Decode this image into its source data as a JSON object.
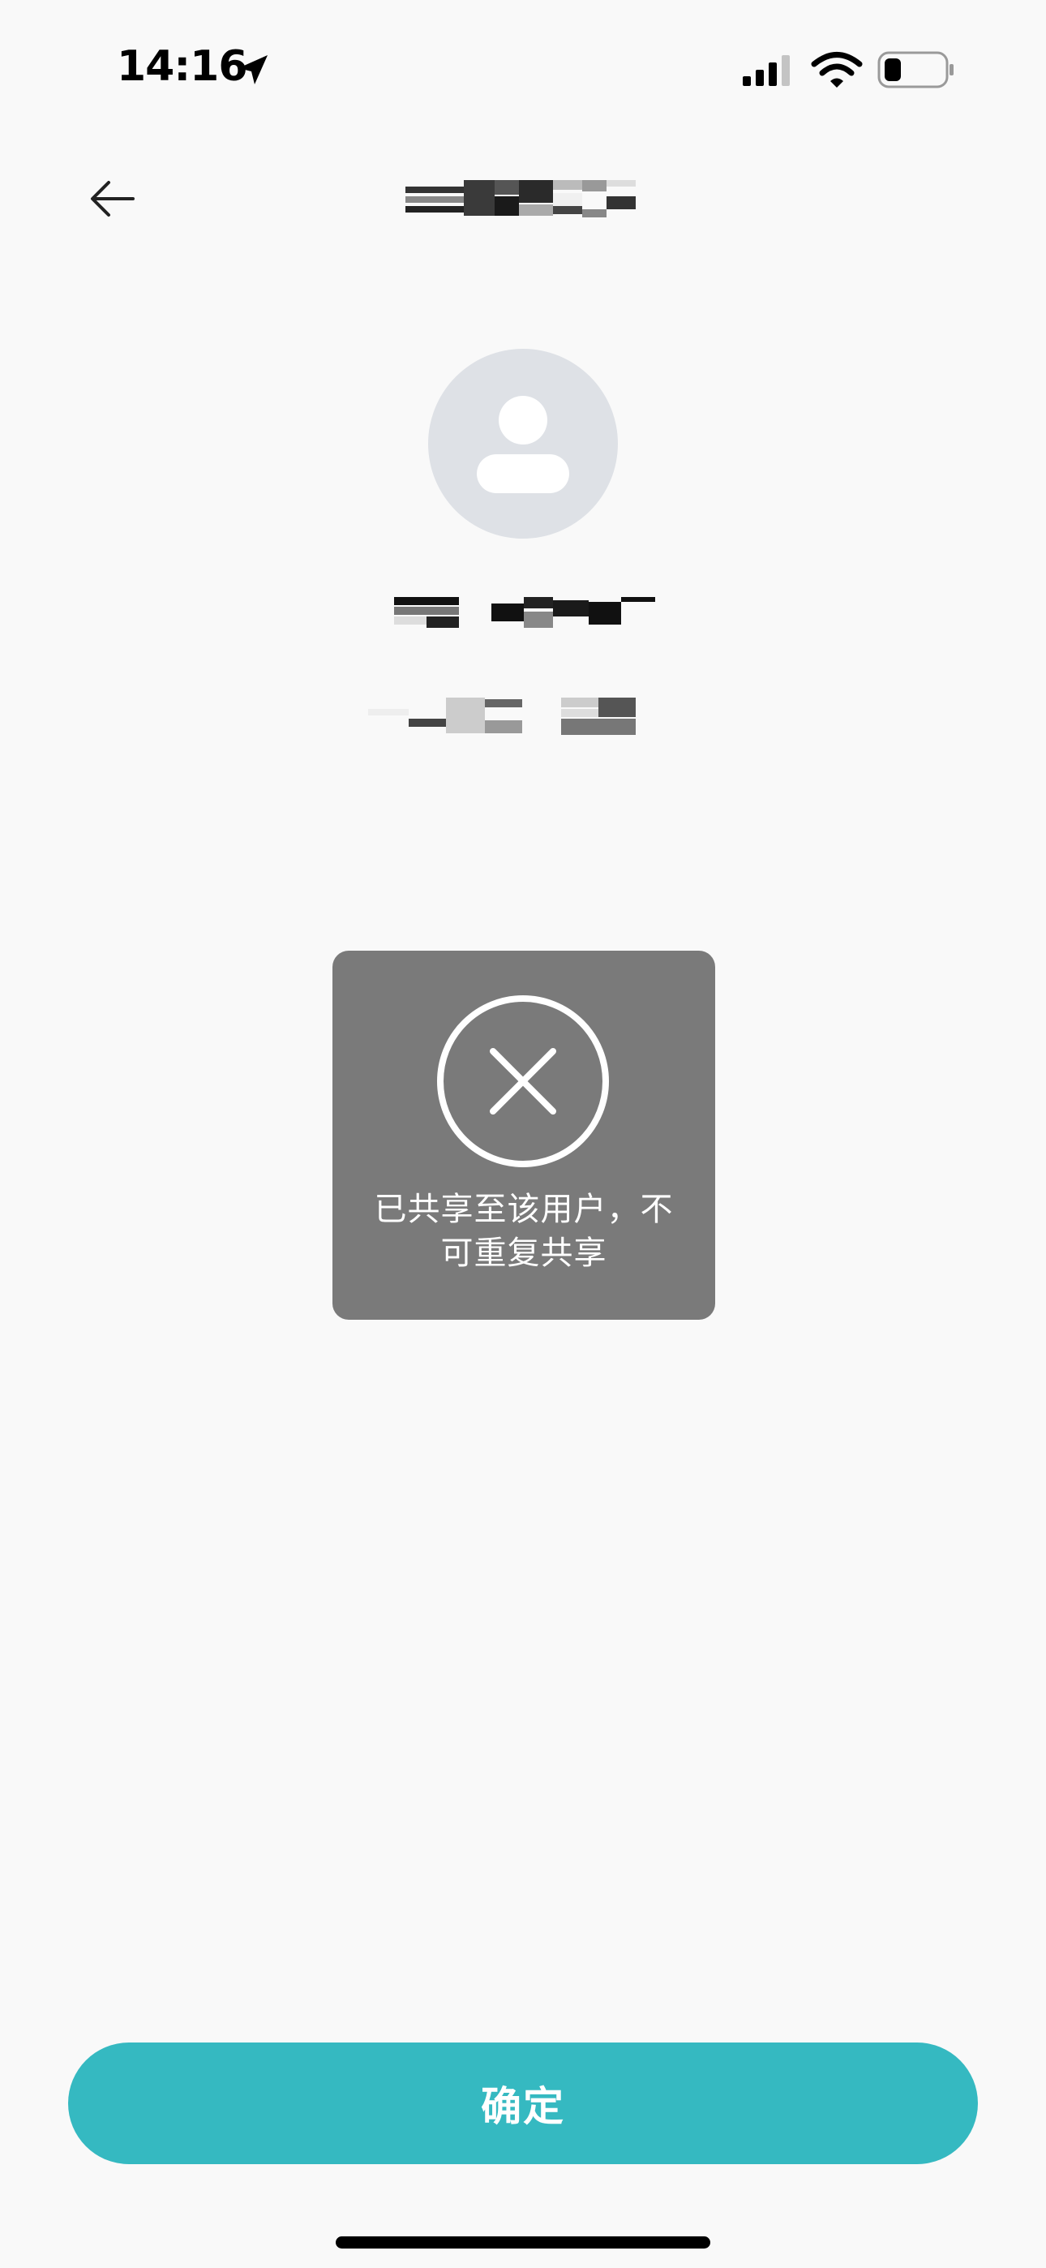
{
  "status_bar": {
    "time": "14:16",
    "location_icon": "location-arrow-icon",
    "signal_icon": "cellular-signal-icon",
    "wifi_icon": "wifi-icon",
    "battery_icon": "battery-low-icon"
  },
  "nav": {
    "back_icon": "arrow-left-icon",
    "title_redacted": true
  },
  "profile": {
    "avatar_icon": "user-silhouette-icon",
    "name_redacted": true,
    "account_redacted": true
  },
  "toast": {
    "icon": "circle-x-icon",
    "message_line1": "已共享至该用户，不",
    "message_line2": "可重复共享"
  },
  "footer": {
    "confirm_label": "确定"
  },
  "colors": {
    "background": "#f9f9f9",
    "accent": "#35b9c1",
    "toast_bg": "#7a7a7a",
    "avatar_bg": "#dee1e6"
  }
}
